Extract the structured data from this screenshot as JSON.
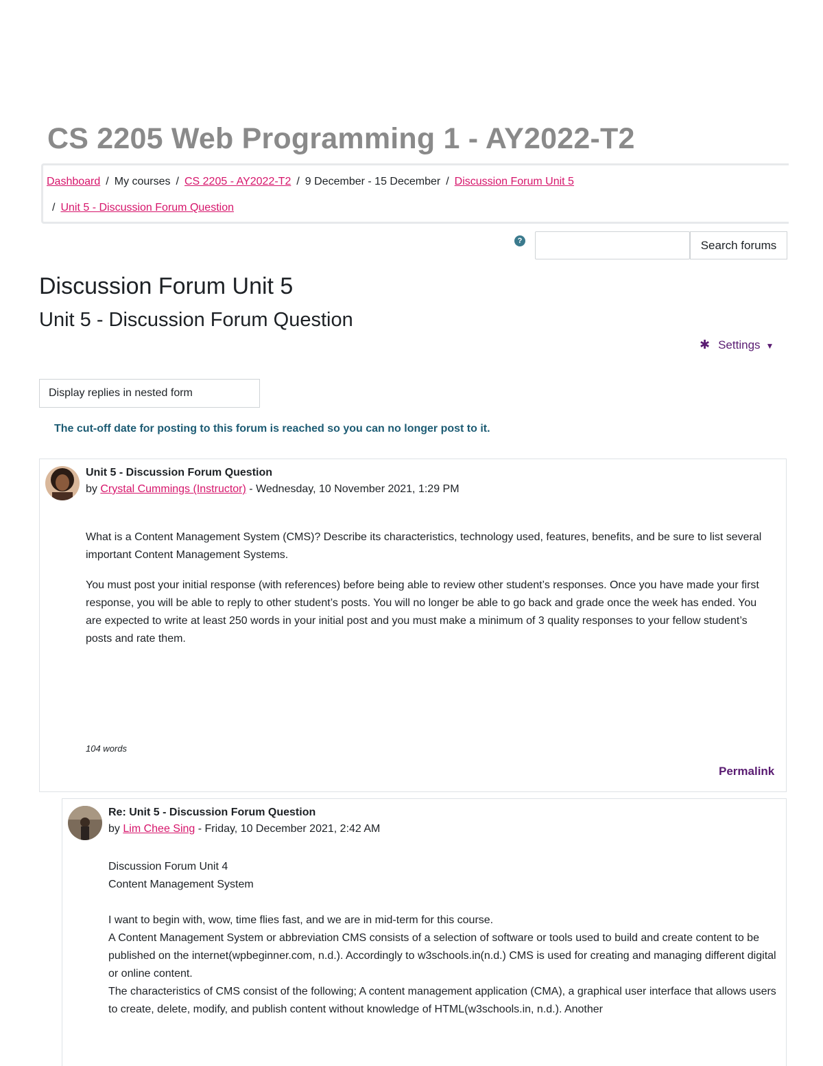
{
  "course": {
    "title": "CS 2205 Web Programming 1 - AY2022-T2"
  },
  "breadcrumb": {
    "dashboard": "Dashboard",
    "my_courses": "My courses",
    "course": "CS 2205 - AY2022-T2",
    "week": "9 December - 15 December",
    "forum": "Discussion Forum Unit 5",
    "discussion": "Unit 5 - Discussion Forum Question",
    "separator": "/"
  },
  "search": {
    "placeholder": "",
    "button_label": "Search forums",
    "help_glyph": "?"
  },
  "forum": {
    "title": "Discussion Forum Unit 5",
    "discussion_title": "Unit 5 - Discussion Forum Question",
    "settings_label": "Settings",
    "display_mode": "Display replies in nested form",
    "cutoff_notice": "The cut-off date for posting to this forum is reached so you can no longer post to it."
  },
  "posts": [
    {
      "subject": "Unit 5 - Discussion Forum Question",
      "by": "by",
      "author": "Crystal Cummings (Instructor)",
      "date": " - Wednesday, 10 November 2021, 1:29 PM",
      "paragraphs": [
        "What is a Content Management System (CMS)? Describe its characteristics, technology used, features, benefits, and be sure to list several important Content Management Systems.",
        "You must post your initial response (with references) before being able to review other student’s responses.  Once you have made your first response, you will be able to reply to other student’s posts.  You will no longer be able to go back and grade once the week has ended.  You are expected to write at least 250 words in your initial post and you must make a minimum of 3 quality responses to your fellow student’s posts and rate them."
      ],
      "word_count": "104 words",
      "permalink": "Permalink"
    },
    {
      "subject": "Re: Unit 5 - Discussion Forum Question",
      "by": "by",
      "author": "Lim Chee Sing",
      "date": " - Friday, 10 December 2021, 2:42 AM",
      "lines": [
        "Discussion Forum Unit 4",
        "Content Management System",
        "I want to begin with, wow, time flies fast, and we are in mid-term for this course.",
        "A Content Management System or abbreviation CMS consists of a selection of software or tools used to build and create content to be published on the internet(wpbeginner.com, n.d.). Accordingly to w3schools.in(n.d.) CMS is used for creating and managing different digital or online content.",
        "The characteristics of CMS consist of the following; A content management application (CMA), a graphical user interface that allows users to create, delete, modify, and publish content without knowledge of HTML(w3schools.in, n.d.). Another"
      ]
    }
  ],
  "colors": {
    "link": "#d6156b",
    "accent": "#5a1c72",
    "notice": "#1c5b73",
    "title_gray": "#8a8a8a"
  }
}
